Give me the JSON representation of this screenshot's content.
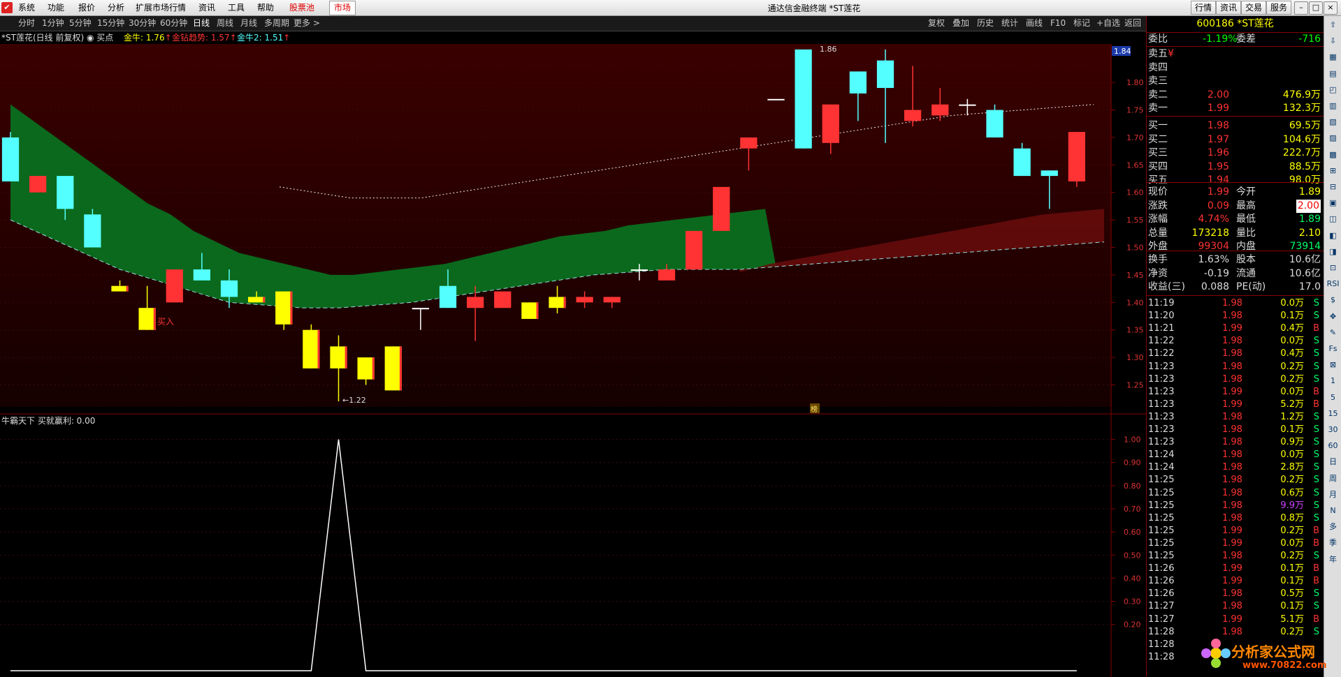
{
  "menubar": {
    "items": [
      "系统",
      "功能",
      "报价",
      "分析",
      "扩展市场行情",
      "资讯",
      "工具",
      "帮助"
    ],
    "stock_pool": "股票池",
    "market_btn": "市场",
    "window_title": "通达信金融终端 *ST莲花",
    "right_buttons": [
      "行情",
      "资讯",
      "交易",
      "服务"
    ],
    "window_controls": [
      "–",
      "□",
      "×"
    ]
  },
  "periodbar": {
    "periods": [
      "分时",
      "1分钟",
      "5分钟",
      "15分钟",
      "30分钟",
      "60分钟",
      "日线",
      "周线",
      "月线",
      "多周期",
      "更多 >"
    ],
    "active_period": "日线",
    "tools": [
      "复权",
      "叠加",
      "历史",
      "统计",
      "画线",
      "F10",
      "标记",
      "+自选",
      "返回"
    ]
  },
  "infoline": {
    "stock_label": "*ST莲花(日线 前复权)",
    "buy_label": "买点",
    "ind1": "金牛: 1.76",
    "ind2": "金钻趋势: 1.57",
    "ind3": "金牛2: 1.51",
    "arrow": "↑"
  },
  "main_chart": {
    "current_price_tag": "1.84",
    "y_ticks": [
      "1.80",
      "1.75",
      "1.70",
      "1.65",
      "1.60",
      "1.55",
      "1.50",
      "1.45",
      "1.40",
      "1.35",
      "1.30",
      "1.25"
    ],
    "high_label": "1.86",
    "low_label": "←1.22",
    "buy_signal": "买入",
    "bang_marker": "榜"
  },
  "chart_data": [
    {
      "type": "candlestick",
      "ylim": [
        1.21,
        1.87
      ],
      "candles": [
        {
          "o": 1.7,
          "c": 1.62,
          "h": 1.71,
          "l": 1.62,
          "color": "cyan"
        },
        {
          "o": 1.6,
          "c": 1.63,
          "h": 1.63,
          "l": 1.6,
          "color": "red"
        },
        {
          "o": 1.63,
          "c": 1.57,
          "h": 1.63,
          "l": 1.55,
          "color": "cyan"
        },
        {
          "o": 1.56,
          "c": 1.5,
          "h": 1.57,
          "l": 1.5,
          "color": "cyan"
        },
        {
          "o": 1.43,
          "c": 1.42,
          "h": 1.44,
          "l": 1.42,
          "color": "yellow"
        },
        {
          "o": 1.39,
          "c": 1.35,
          "h": 1.43,
          "l": 1.35,
          "color": "yellow"
        },
        {
          "o": 1.4,
          "c": 1.46,
          "h": 1.46,
          "l": 1.4,
          "color": "red"
        },
        {
          "o": 1.46,
          "c": 1.44,
          "h": 1.49,
          "l": 1.44,
          "color": "cyan"
        },
        {
          "o": 1.44,
          "c": 1.41,
          "h": 1.46,
          "l": 1.39,
          "color": "cyan"
        },
        {
          "o": 1.41,
          "c": 1.4,
          "h": 1.42,
          "l": 1.4,
          "color": "yellow"
        },
        {
          "o": 1.42,
          "c": 1.36,
          "h": 1.42,
          "l": 1.35,
          "color": "yellow"
        },
        {
          "o": 1.35,
          "c": 1.28,
          "h": 1.36,
          "l": 1.28,
          "color": "yellow"
        },
        {
          "o": 1.32,
          "c": 1.28,
          "h": 1.34,
          "l": 1.22,
          "color": "yellow"
        },
        {
          "o": 1.3,
          "c": 1.26,
          "h": 1.3,
          "l": 1.25,
          "color": "yellow"
        },
        {
          "o": 1.32,
          "c": 1.24,
          "h": 1.32,
          "l": 1.24,
          "color": "yellow"
        },
        {
          "o": 1.39,
          "c": 1.39,
          "h": 1.39,
          "l": 1.35,
          "color": "white"
        },
        {
          "o": 1.43,
          "c": 1.39,
          "h": 1.46,
          "l": 1.39,
          "color": "cyan"
        },
        {
          "o": 1.39,
          "c": 1.41,
          "h": 1.43,
          "l": 1.33,
          "color": "red"
        },
        {
          "o": 1.39,
          "c": 1.42,
          "h": 1.42,
          "l": 1.39,
          "color": "red"
        },
        {
          "o": 1.4,
          "c": 1.37,
          "h": 1.4,
          "l": 1.37,
          "color": "yellow"
        },
        {
          "o": 1.41,
          "c": 1.39,
          "h": 1.43,
          "l": 1.38,
          "color": "yellow"
        },
        {
          "o": 1.4,
          "c": 1.41,
          "h": 1.42,
          "l": 1.39,
          "color": "red"
        },
        {
          "o": 1.4,
          "c": 1.41,
          "h": 1.41,
          "l": 1.39,
          "color": "red"
        },
        {
          "o": 1.46,
          "c": 1.46,
          "h": 1.47,
          "l": 1.44,
          "color": "white"
        },
        {
          "o": 1.44,
          "c": 1.46,
          "h": 1.47,
          "l": 1.44,
          "color": "red"
        },
        {
          "o": 1.46,
          "c": 1.53,
          "h": 1.53,
          "l": 1.46,
          "color": "red"
        },
        {
          "o": 1.53,
          "c": 1.61,
          "h": 1.61,
          "l": 1.53,
          "color": "red"
        },
        {
          "o": 1.68,
          "c": 1.7,
          "h": 1.7,
          "l": 1.64,
          "color": "red"
        },
        {
          "o": 1.77,
          "c": 1.77,
          "h": 1.77,
          "l": 1.77,
          "color": "white"
        },
        {
          "o": 1.86,
          "c": 1.68,
          "h": 1.86,
          "l": 1.68,
          "color": "cyan"
        },
        {
          "o": 1.69,
          "c": 1.76,
          "h": 1.76,
          "l": 1.67,
          "color": "red"
        },
        {
          "o": 1.82,
          "c": 1.78,
          "h": 1.82,
          "l": 1.73,
          "color": "cyan"
        },
        {
          "o": 1.84,
          "c": 1.79,
          "h": 1.86,
          "l": 1.69,
          "color": "cyan"
        },
        {
          "o": 1.73,
          "c": 1.75,
          "h": 1.83,
          "l": 1.72,
          "color": "red"
        },
        {
          "o": 1.74,
          "c": 1.76,
          "h": 1.79,
          "l": 1.73,
          "color": "red"
        },
        {
          "o": 1.76,
          "c": 1.76,
          "h": 1.77,
          "l": 1.74,
          "color": "white"
        },
        {
          "o": 1.75,
          "c": 1.7,
          "h": 1.76,
          "l": 1.7,
          "color": "cyan"
        },
        {
          "o": 1.68,
          "c": 1.63,
          "h": 1.69,
          "l": 1.63,
          "color": "cyan"
        },
        {
          "o": 1.64,
          "c": 1.63,
          "h": 1.64,
          "l": 1.57,
          "color": "cyan"
        },
        {
          "o": 1.62,
          "c": 1.71,
          "h": 1.71,
          "l": 1.61,
          "color": "red"
        }
      ],
      "lines": {
        "upper_band": [
          1.76,
          1.73,
          1.7,
          1.67,
          1.64,
          1.61,
          1.58,
          1.56,
          1.53,
          1.51,
          1.49,
          1.48,
          1.47,
          1.46,
          1.45,
          1.45,
          1.455,
          1.46,
          1.465,
          1.47,
          1.48,
          1.49,
          1.5,
          1.51,
          1.52,
          1.525,
          1.53,
          1.54,
          1.545,
          1.55,
          1.555,
          1.56,
          1.565,
          1.57
        ],
        "lower_band": [
          1.55,
          1.52,
          1.49,
          1.46,
          1.44,
          1.42,
          1.4,
          1.395,
          1.39,
          1.39,
          1.395,
          1.4,
          1.41,
          1.42,
          1.43,
          1.44,
          1.45,
          1.455,
          1.46,
          1.46,
          1.46,
          1.465,
          1.47,
          1.475,
          1.48,
          1.485,
          1.49,
          1.495,
          1.5,
          1.505,
          1.51
        ],
        "dotted_ma": [
          1.61,
          1.6,
          1.59,
          1.59,
          1.59,
          1.6,
          1.61,
          1.62,
          1.63,
          1.64,
          1.65,
          1.66,
          1.67,
          1.68,
          1.69,
          1.7,
          1.71,
          1.72,
          1.73,
          1.74,
          1.745,
          1.75,
          1.755,
          1.76
        ]
      }
    },
    {
      "type": "line",
      "title": "牛霸天下 买就赢利: 0.00",
      "ylim": [
        0,
        1.05
      ],
      "y_ticks": [
        "1.00",
        "0.90",
        "0.80",
        "0.70",
        "0.60",
        "0.50",
        "0.40",
        "0.30",
        "0.20"
      ],
      "values": [
        0,
        0,
        0,
        0,
        0,
        0,
        0,
        0,
        0,
        0,
        0,
        0,
        1,
        0,
        0,
        0,
        0,
        0,
        0,
        0,
        0,
        0,
        0,
        0,
        0,
        0,
        0,
        0,
        0,
        0,
        0,
        0,
        0,
        0,
        0,
        0,
        0,
        0,
        0,
        0
      ]
    }
  ],
  "right_panel": {
    "header": "600186 *ST莲花",
    "weibi": {
      "label": "委比",
      "val": "-1.19%",
      "label2": "委差",
      "val2": "-716"
    },
    "asks": [
      {
        "label": "卖五",
        "price": "¥",
        "vol": ""
      },
      {
        "label": "卖四",
        "price": "",
        "vol": ""
      },
      {
        "label": "卖三",
        "price": "",
        "vol": ""
      },
      {
        "label": "卖二",
        "price": "2.00",
        "vol": "476.9万"
      },
      {
        "label": "卖一",
        "price": "1.99",
        "vol": "132.3万"
      }
    ],
    "bids": [
      {
        "label": "买一",
        "price": "1.98",
        "vol": "69.5万"
      },
      {
        "label": "买二",
        "price": "1.97",
        "vol": "104.6万"
      },
      {
        "label": "买三",
        "price": "1.96",
        "vol": "222.7万"
      },
      {
        "label": "买四",
        "price": "1.95",
        "vol": "88.5万"
      },
      {
        "label": "买五",
        "price": "1.94",
        "vol": "98.0万"
      }
    ],
    "stats": [
      {
        "l1": "现价",
        "v1": "1.99",
        "l2": "今开",
        "v2": "1.89"
      },
      {
        "l1": "涨跌",
        "v1": "0.09",
        "l2": "最高",
        "v2": "2.00"
      },
      {
        "l1": "涨幅",
        "v1": "4.74%",
        "l2": "最低",
        "v2": "1.89"
      },
      {
        "l1": "总量",
        "v1": "173218",
        "l2": "量比",
        "v2": "2.10"
      },
      {
        "l1": "外盘",
        "v1": "99304",
        "l2": "内盘",
        "v2": "73914"
      }
    ],
    "stats2": [
      {
        "l1": "换手",
        "v1": "1.63%",
        "l2": "股本",
        "v2": "10.6亿"
      },
      {
        "l1": "净资",
        "v1": "-0.19",
        "l2": "流通",
        "v2": "10.6亿"
      },
      {
        "l1": "收益(三)",
        "v1": "0.088",
        "l2": "PE(动)",
        "v2": "17.0"
      }
    ],
    "ticks": [
      [
        "11:19",
        "1.98",
        "0.0万",
        "S"
      ],
      [
        "11:20",
        "1.98",
        "0.1万",
        "S"
      ],
      [
        "11:21",
        "1.99",
        "0.4万",
        "B"
      ],
      [
        "11:22",
        "1.98",
        "0.0万",
        "S"
      ],
      [
        "11:22",
        "1.98",
        "0.4万",
        "S"
      ],
      [
        "11:23",
        "1.98",
        "0.2万",
        "S"
      ],
      [
        "11:23",
        "1.98",
        "0.2万",
        "S"
      ],
      [
        "11:23",
        "1.99",
        "0.0万",
        "B"
      ],
      [
        "11:23",
        "1.99",
        "5.2万",
        "B"
      ],
      [
        "11:23",
        "1.98",
        "1.2万",
        "S"
      ],
      [
        "11:23",
        "1.98",
        "0.1万",
        "S"
      ],
      [
        "11:23",
        "1.98",
        "0.9万",
        "S"
      ],
      [
        "11:24",
        "1.98",
        "0.0万",
        "S"
      ],
      [
        "11:24",
        "1.98",
        "2.8万",
        "S"
      ],
      [
        "11:25",
        "1.98",
        "0.2万",
        "S"
      ],
      [
        "11:25",
        "1.98",
        "0.6万",
        "S"
      ],
      [
        "11:25",
        "1.98",
        "9.9万",
        "S"
      ],
      [
        "11:25",
        "1.98",
        "0.8万",
        "S"
      ],
      [
        "11:25",
        "1.99",
        "0.2万",
        "B"
      ],
      [
        "11:25",
        "1.99",
        "0.0万",
        "B"
      ],
      [
        "11:25",
        "1.98",
        "0.2万",
        "S"
      ],
      [
        "11:26",
        "1.99",
        "0.1万",
        "B"
      ],
      [
        "11:26",
        "1.99",
        "0.1万",
        "B"
      ],
      [
        "11:26",
        "1.98",
        "0.5万",
        "S"
      ],
      [
        "11:27",
        "1.98",
        "0.1万",
        "S"
      ],
      [
        "11:27",
        "1.99",
        "5.1万",
        "B"
      ],
      [
        "11:28",
        "1.98",
        "0.2万",
        "S"
      ],
      [
        "11:28",
        "",
        "",
        ""
      ],
      [
        "11:28",
        "",
        "",
        ""
      ]
    ]
  },
  "sidebar": {
    "items": [
      "⇧",
      "⇩",
      "▦",
      "▤",
      "◰",
      "▥",
      "▧",
      "▨",
      "▩",
      "⊞",
      "⊟",
      "▣",
      "◫",
      "◧",
      "◨",
      "⊡",
      "RSI",
      "$",
      "✥",
      "✎",
      "Fs",
      "⊠",
      "1",
      "5",
      "15",
      "30",
      "60",
      "日",
      "周",
      "月",
      "N",
      "多",
      "季",
      "年"
    ]
  },
  "watermark": {
    "text": "分析家公式网",
    "url": "www.70822.com"
  },
  "colors": {
    "up": "#ff3333",
    "down": "#54ffff",
    "yellow": "#ffff00",
    "border": "#8a0000",
    "green_fill": "#0a6f1f",
    "red_fill": "#5a0808"
  }
}
